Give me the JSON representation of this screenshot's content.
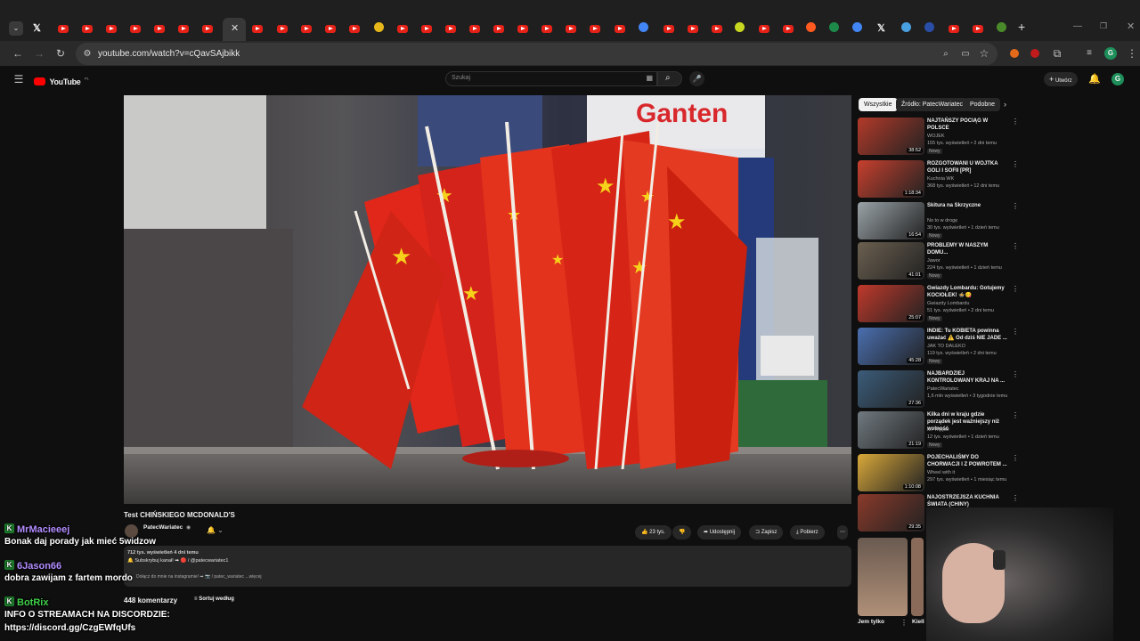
{
  "browser": {
    "url": "youtube.com/watch?v=cQavSAjbikk",
    "new_tab_glyph": "+"
  },
  "youtube": {
    "logo_text": "YouTube",
    "logo_sup": "PL",
    "search_placeholder": "Szukaj",
    "create_label": "Utwórz",
    "avatar_letter": "G"
  },
  "video": {
    "title": "Test CHIŃSKIEGO MCDONALD'S",
    "channel": "PatecWariatec",
    "subscribers": "",
    "likes": "23 tys.",
    "share": "Udostępnij",
    "save": "Zapisz",
    "download": "Pobierz",
    "desc_meta": "712 tys. wyświetleń  4 dni temu",
    "desc_line1": "🔔 Subskrybuj kanał! ➡ 🔴 / @patecwariatec1",
    "desc_line2": "Dołącz do mnie na instagramie! ➡ 📷 / patec_wariatec ...więcej",
    "comments_count": "448 komentarzy",
    "sort_label": "Sortuj według"
  },
  "sidebar": {
    "chips": [
      "Wszystkie",
      "Źródło: PatecWariatec",
      "Podobne"
    ],
    "items": [
      {
        "title": "NAJTAŃSZY POCIĄG W POLSCE",
        "channel": "WOJEK",
        "meta": "155 tys. wyświetleń • 2 dni temu",
        "badge": "Nowy",
        "duration": "38:52",
        "color": "#b33a2a"
      },
      {
        "title": "ROZGOTOWANI U WOJTKA GOLI I SOFII [PR]",
        "channel": "Kuchnia WK",
        "meta": "368 tys. wyświetleń • 12 dni temu",
        "badge": "",
        "duration": "1:18:34",
        "color": "#c8402e"
      },
      {
        "title": "Skitura na Skrzyczne",
        "channel": "No to w drogę",
        "meta": "30 tys. wyświetleń • 1 dzień temu",
        "badge": "Nowy",
        "duration": "16:54",
        "color": "#9aa3a8"
      },
      {
        "title": "PROBLEMY W NASZYM DOMU...",
        "channel": "Jawor",
        "meta": "224 tys. wyświetleń • 1 dzień temu",
        "badge": "Nowy",
        "duration": "41:01",
        "color": "#6b6050"
      },
      {
        "title": "Gwiazdy Lombardu: Gotujemy KOCIOŁEK! 🍲😋",
        "channel": "Gwiazdy Lombardu",
        "meta": "51 tys. wyświetleń • 2 dni temu",
        "badge": "Nowy",
        "duration": "25:07",
        "color": "#c0392b"
      },
      {
        "title": "INDIE: Tu KOBIETA powinna uważać ⚠️ Od dziś NIE JADE ...",
        "channel": "JAK TO DALEKO",
        "meta": "119 tys. wyświetleń • 2 dni temu",
        "badge": "Nowy",
        "duration": "45:28",
        "color": "#4a6fb0"
      },
      {
        "title": "NAJBARDZIEJ KONTROLOWANY KRAJ NA ...",
        "channel": "PatecWariatec",
        "meta": "1,6 mln wyświetleń • 3 tygodnie temu",
        "badge": "",
        "duration": "27:36",
        "color": "#3b5c7a"
      },
      {
        "title": "Kilka dni w kraju gdzie porządek jest ważniejszy niż wolność",
        "channel": "Mr Tripper",
        "meta": "12 tys. wyświetleń • 1 dzień temu",
        "badge": "Nowy",
        "duration": "21:19",
        "color": "#707a80"
      },
      {
        "title": "POJECHALIŚMY DO CHORWACJI I Z POWROTEM ...",
        "channel": "Wheel with it",
        "meta": "297 tys. wyświetleń • 1 miesiąc temu",
        "badge": "",
        "duration": "1:10:08",
        "color": "#d9a83a"
      },
      {
        "title": "NAJOSTRZEJSZA KUCHNIA ŚWIATA (CHINY)",
        "channel": "",
        "meta": "",
        "badge": "",
        "duration": "29:35",
        "color": "#8a3a2a"
      }
    ],
    "shorts": [
      {
        "title": "Jem tylko"
      },
      {
        "title": "Kiell"
      }
    ]
  },
  "chat": [
    {
      "user": "MrMacieeej",
      "color": "#b28cff",
      "msg": "Bonak daj porady jak mieć 5widzow"
    },
    {
      "user": "6Jason66",
      "color": "#b28cff",
      "msg": "dobra zawijam z fartem mordo"
    },
    {
      "user": "BotRix",
      "color": "#3fd04a",
      "msg": "INFO O STREAMACH NA DISCORDZIE:"
    }
  ],
  "chat_link": "https://discord.gg/CzgEWfqUfs"
}
